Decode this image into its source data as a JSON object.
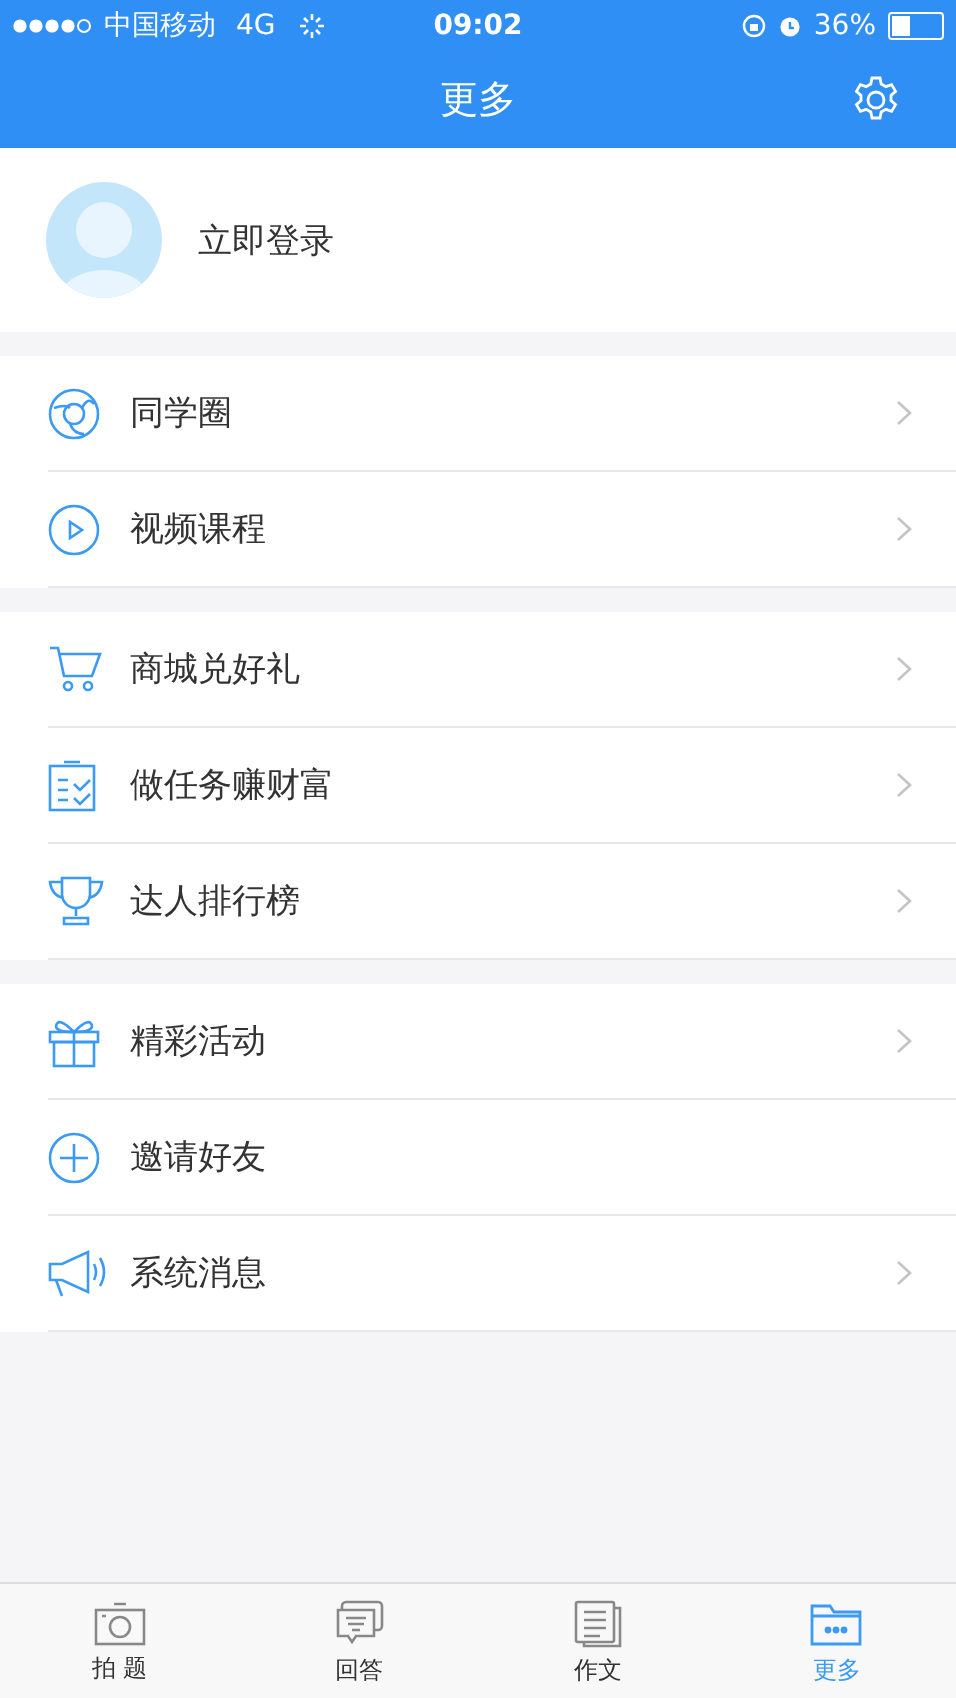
{
  "status_bar": {
    "carrier": "中国移动",
    "network": "4G",
    "time": "09:02",
    "battery": "36%"
  },
  "nav_bar": {
    "title": "更多"
  },
  "profile": {
    "login": "立即登录"
  },
  "groups": [
    {
      "items": [
        {
          "label": "同学圈",
          "chevron": true
        },
        {
          "label": "视频课程",
          "chevron": true
        }
      ]
    },
    {
      "items": [
        {
          "label": "商城兑好礼",
          "chevron": true
        },
        {
          "label": "做任务赚财富",
          "chevron": true
        },
        {
          "label": "达人排行榜",
          "chevron": true
        }
      ]
    },
    {
      "items": [
        {
          "label": "精彩活动",
          "chevron": true
        },
        {
          "label": "邀请好友",
          "chevron": false
        },
        {
          "label": "系统消息",
          "chevron": true
        }
      ]
    }
  ],
  "tab_bar": [
    {
      "label": "拍 题",
      "selected": false
    },
    {
      "label": "回答",
      "selected": false
    },
    {
      "label": "作文",
      "selected": false
    },
    {
      "label": "更多",
      "selected": true
    }
  ]
}
